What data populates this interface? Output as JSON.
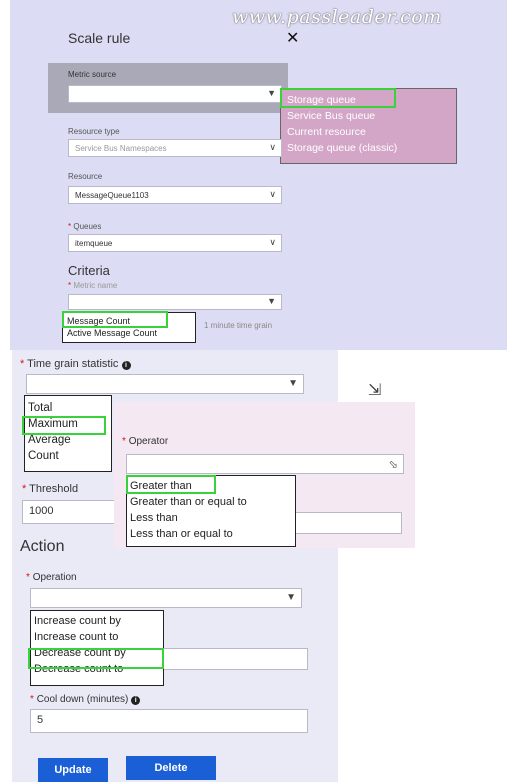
{
  "watermark": "www.passleader.com",
  "panel": {
    "title": "Scale rule",
    "close_icon": "close-icon",
    "metric_source": {
      "label": "Metric source",
      "value": "",
      "options": [
        "Storage queue",
        "Service Bus queue",
        "Current resource",
        "Storage queue (classic)"
      ],
      "highlighted": "Storage queue"
    },
    "resource_type": {
      "label": "Resource type",
      "value": "Service Bus Namespaces"
    },
    "resource": {
      "label": "Resource",
      "value": "MessageQueue1103"
    },
    "queues": {
      "required": "*",
      "label": "Queues",
      "value": "itemqueue"
    },
    "criteria_heading": "Criteria",
    "metric_name": {
      "required": "*",
      "label": "Metric name",
      "value": "",
      "options": [
        "Message Count",
        "Active Message Count"
      ],
      "highlighted": "Message Count",
      "side_text": "1 minute time grain"
    },
    "time_grain": {
      "required": "*",
      "label": "Time grain statistic",
      "info_icon": "info-icon",
      "value": "",
      "options": [
        "Total",
        "Maximum",
        "Average",
        "Count"
      ],
      "highlighted": "Maximum"
    },
    "operator": {
      "required": "*",
      "label": "Operator",
      "value": "",
      "options": [
        "Greater than",
        "Greater than or equal to",
        "Less than",
        "Less than or equal to"
      ],
      "highlighted": "Greater than"
    },
    "threshold": {
      "required": "*",
      "label": "Threshold",
      "value": "1000"
    },
    "action_heading": "Action",
    "operation": {
      "required": "*",
      "label": "Operation",
      "value": "",
      "options": [
        "Increase count by",
        "Increase count to",
        "Decrease count by",
        "Decrease count to"
      ],
      "highlighted": "Decrease count by"
    },
    "cool_down": {
      "required": "*",
      "label": "Cool down (minutes)",
      "info_icon": "info-icon",
      "value": "5"
    },
    "buttons": {
      "update": "Update",
      "delete": "Delete"
    }
  },
  "colors": {
    "highlight": "#3ad13a",
    "button": "#1a5fd6",
    "panel_top_bg": "#dcdcf4",
    "panel_bottom_bg": "#eaeaf7"
  }
}
